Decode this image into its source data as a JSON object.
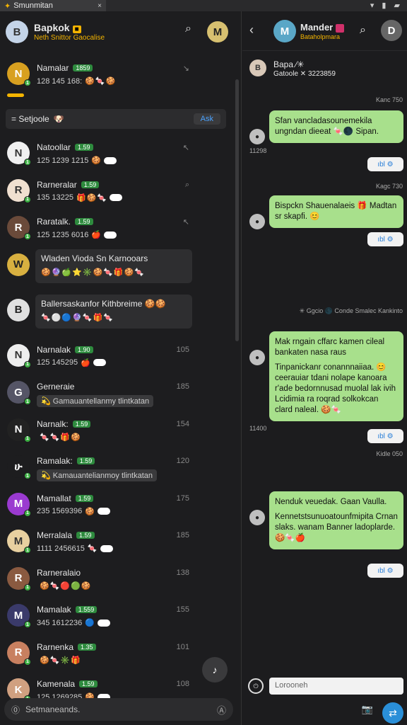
{
  "tab": {
    "title": "Smunmitan",
    "close": "×",
    "system_icons": "▾ ▮ ▰"
  },
  "header": {
    "avatar_letter": "B",
    "name": "Bapkok",
    "badge": "■",
    "subtitle": "Neth Snittor Gaocalise",
    "search_icon": "⌕",
    "me_letter": "M"
  },
  "pinned": {
    "avatar_letter": "N",
    "title": "Namalar",
    "tag": "1859",
    "preview": "128 145 168:",
    "emojis": "🍪🍬🍪",
    "time": "↘"
  },
  "section": {
    "title": "= Setjoole",
    "emoji": "🐶",
    "button": "Ask"
  },
  "chats": [
    {
      "avatar_letter": "N",
      "avatar_color": "#f0f0f0",
      "title": "Natoollar",
      "tag": "1.59",
      "preview": "125 1239 1215",
      "emojis": "🍪",
      "time": "↖"
    },
    {
      "avatar_letter": "R",
      "avatar_color": "#f0e0d0",
      "title": "Rarneralar",
      "tag": "1.59",
      "preview": "135 13225",
      "emojis": "🎁🍪🍬",
      "time": "⌕"
    },
    {
      "avatar_letter": "R",
      "avatar_color": "#6a4a3a",
      "title": "Raratalk.",
      "tag": "1.59",
      "preview": "125 1235 6016",
      "emojis": "🍎",
      "time": "↖"
    }
  ],
  "bubble_rows": [
    {
      "avatar_letter": "W",
      "avatar_color": "#d8b040",
      "text": "Wladen Vioda Sn Karnooars",
      "emojis": "🍪🔮🍏⭐✳️🍪🍬🎁🍪🍬"
    },
    {
      "avatar_letter": "B",
      "avatar_color": "#e0e0e0",
      "text": "Ballersaskanfor Kithbreime 🍪🍪",
      "emojis": "🍬⚪🔵🔮🍬🎁🍬"
    }
  ],
  "chats2": [
    {
      "avatar_letter": "N",
      "avatar_color": "#eee",
      "title": "Narnalak",
      "tag": "1.90",
      "preview": "125 145295",
      "emojis": "🍎",
      "time": "105"
    },
    {
      "avatar_letter": "G",
      "avatar_color": "#556",
      "title": "Gerneraie",
      "tag": "",
      "preview": "💫 Gamauantellanmy tlintkatan",
      "emojis": "",
      "time": "185",
      "quoted": true
    },
    {
      "avatar_letter": "N",
      "avatar_color": "#222",
      "title": "Narnalk:",
      "tag": "1.59",
      "preview": "",
      "emojis": "🍬🍬🎁🍪",
      "time": "154"
    },
    {
      "avatar_letter": "ሁ",
      "avatar_color": "#1d1d1f",
      "title": "Ramalak:",
      "tag": "1.59",
      "preview": "💫 Kamauantelianmoy tlintkatan",
      "emojis": "",
      "time": "120",
      "quoted": true
    },
    {
      "avatar_letter": "M",
      "avatar_color": "#9a3ad0",
      "title": "Mamallat",
      "tag": "1.59",
      "preview": "235 1569396",
      "emojis": "🍪",
      "time": "175"
    },
    {
      "avatar_letter": "M",
      "avatar_color": "#e8d0a0",
      "title": "Merralala",
      "tag": "1.59",
      "preview": "1111 2456615",
      "emojis": "🍬",
      "time": "185"
    },
    {
      "avatar_letter": "R",
      "avatar_color": "#8a5a40",
      "title": "Rarneralaio",
      "tag": "",
      "preview": "",
      "emojis": "🍪🍬🔴🟢🍪",
      "time": "138"
    },
    {
      "avatar_letter": "M",
      "avatar_color": "#3a3a6a",
      "title": "Mamalak",
      "tag": "1.559",
      "preview": "345 1612236",
      "emojis": "🔵",
      "time": "155"
    },
    {
      "avatar_letter": "R",
      "avatar_color": "#c88060",
      "title": "Rarnenka",
      "tag": "1.35",
      "preview": "",
      "emojis": "🍪🍬✳️🎁",
      "time": "101"
    },
    {
      "avatar_letter": "K",
      "avatar_color": "#d0a080",
      "title": "Kamenala",
      "tag": "1.59",
      "preview": "125 1269285",
      "emojis": "🍪",
      "time": "108"
    }
  ],
  "fab_icon": "♪",
  "footer": {
    "placeholder": "Setmaneands.",
    "mic_icon": "⓪",
    "btn_icon": "Ⓐ"
  },
  "conversation": {
    "avatar_letter": "M",
    "name": "Mander",
    "subtitle": "Bataholpmara",
    "back_icon": "‹",
    "search_icon": "⌕",
    "me_letter": "D",
    "info_name": "Bapa ⁄✳",
    "info_sub": "Gatoole ✕ 3223859",
    "info_letter": "B",
    "messages": [
      {
        "label": "Kanc 750",
        "lines": [
          "Sfan vancladasounemekila ungndan dieeat 🍬🌑 Sipan."
        ],
        "time": "11298",
        "react": "ıbl ⚙"
      },
      {
        "label": "Kagc 730",
        "lines": [
          "Bispckn Shauenalaeis 🎁 Madtan sr skapfi. 😊"
        ],
        "time": "",
        "react": "ıbl ⚙"
      },
      {
        "label": "✳ Ggcio 🌑 Conde  Smalec  Kankinto",
        "lines": [
          "Mak rngain cffarc kamen cileal bankaten nasa raus",
          "Tinpanickanr conannnaiiaa. 😊 ceerauiar tdani nolape kanoara r'ade bedornnusad muolal lak ivih Lcidimia ra roqrad solkokcan clard naleal. 🍪🍬"
        ],
        "time": "11400",
        "react": "ıbl ⚙"
      },
      {
        "label": "Kidle 050",
        "lines": [
          "Nenduk veuedak. Gaan Vaulla.",
          "Kennetstsunuoatounfmipita Crnan slaks. wanam Banner ladoplarde. 🍪🍬🍎"
        ],
        "time": "",
        "react": "ıbl ⚙"
      }
    ],
    "input_placeholder": "Lorooneh",
    "cam_icon": "📷",
    "send_icon": "⇄"
  }
}
